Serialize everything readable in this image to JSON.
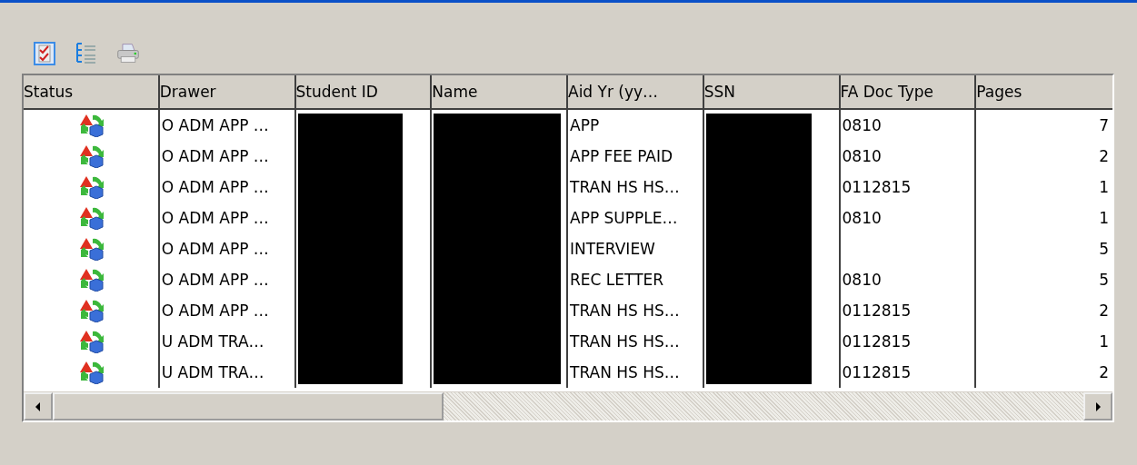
{
  "toolbar": [
    {
      "kind": "checklist"
    },
    {
      "kind": "tree"
    },
    {
      "kind": "print"
    }
  ],
  "table": {
    "columns": [
      {
        "label": "Status",
        "kind": "icon"
      },
      {
        "label": "Drawer",
        "kind": "text"
      },
      {
        "label": "Student ID",
        "kind": "redacted"
      },
      {
        "label": "Name",
        "kind": "redacted"
      },
      {
        "label": "Aid Yr (yy…",
        "kind": "text"
      },
      {
        "label": "SSN",
        "kind": "redacted"
      },
      {
        "label": "FA Doc Type",
        "kind": "text"
      },
      {
        "label": "Pages",
        "kind": "number"
      }
    ],
    "rows": [
      {
        "drawer": "O ADM APP …",
        "aid_yr": "APP",
        "doc_type": "0810",
        "pages": "7"
      },
      {
        "drawer": "O ADM APP …",
        "aid_yr": "APP FEE PAID",
        "doc_type": "0810",
        "pages": "2"
      },
      {
        "drawer": "O ADM APP …",
        "aid_yr": "TRAN HS HS…",
        "doc_type": "0112815",
        "pages": "1"
      },
      {
        "drawer": "O ADM APP …",
        "aid_yr": "APP SUPPLE…",
        "doc_type": "0810",
        "pages": "1"
      },
      {
        "drawer": "O ADM APP …",
        "aid_yr": "INTERVIEW",
        "pages": "5"
      },
      {
        "drawer": "O ADM APP …",
        "aid_yr": "REC LETTER",
        "doc_type": "0810",
        "pages": "5"
      },
      {
        "drawer": "O ADM APP …",
        "aid_yr": "TRAN HS HS…",
        "doc_type": "0112815",
        "pages": "2"
      },
      {
        "drawer": "U ADM TRA…",
        "aid_yr": "TRAN HS HS…",
        "doc_type": "0112815",
        "pages": "1"
      },
      {
        "drawer": "U ADM TRA…",
        "aid_yr": "TRAN HS HS…",
        "doc_type": "0112815",
        "pages": "2"
      }
    ]
  }
}
